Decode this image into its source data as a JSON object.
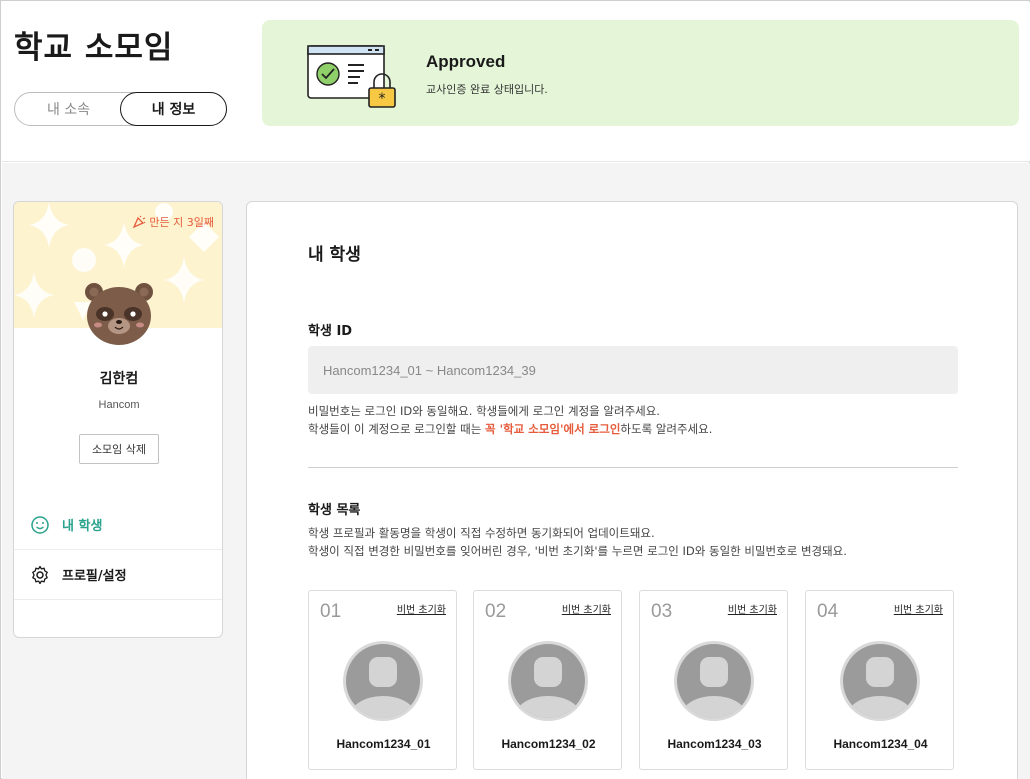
{
  "header": {
    "title": "학교 소모임",
    "tabs": [
      {
        "label": "내 소속",
        "active": false
      },
      {
        "label": "내 정보",
        "active": true
      }
    ]
  },
  "banner": {
    "title": "Approved",
    "subtitle": "교사인증 완료 상태입니다.",
    "illustration": "certificate-lock-icon",
    "background": "#e5f6d8"
  },
  "sidebar": {
    "badge": "만든 지 3일째",
    "badge_icon": "party-popper-icon",
    "name": "김한컴",
    "org": "Hancom",
    "delete_label": "소모임 삭제",
    "nav": [
      {
        "label": "내 학생",
        "icon": "smile-icon",
        "active": true
      },
      {
        "label": "프로필/설정",
        "icon": "gear-icon",
        "active": false
      }
    ],
    "accent": "#2aa38c"
  },
  "main": {
    "title": "내 학생",
    "student_id_label": "학생 ID",
    "student_id_value": "Hancom1234_01 ~ Hancom1234_39",
    "note1": "비밀번호는 로그인 ID와 동일해요. 학생들에게 로그인 계정을 알려주세요.",
    "note2_pre": "학생들이 이 계정으로 로그인할 때는 ",
    "note2_emph": "꼭 '학교 소모임'에서 로그인",
    "note2_post": "하도록 알려주세요.",
    "list_title": "학생 목록",
    "list_desc1": "학생 프로필과 활동명을 학생이 직접 수정하면 동기화되어 업데이트돼요.",
    "list_desc2": "학생이 직접 변경한 비밀번호를 잊어버린 경우, '비번 초기화'를 누르면 로그인 ID와 동일한 비밀번호로 변경돼요.",
    "students": [
      {
        "num": "01",
        "reset": "비번 초기화",
        "name": "Hancom1234_01"
      },
      {
        "num": "02",
        "reset": "비번 초기화",
        "name": "Hancom1234_02"
      },
      {
        "num": "03",
        "reset": "비번 초기화",
        "name": "Hancom1234_03"
      },
      {
        "num": "04",
        "reset": "비번 초기화",
        "name": "Hancom1234_04"
      }
    ],
    "emphasis_color": "#e65b3b"
  }
}
